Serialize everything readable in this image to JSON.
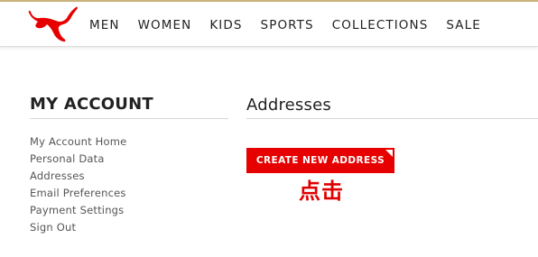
{
  "colors": {
    "brand_red": "#e60000",
    "top_line": "#c9b37a",
    "annotation": "#e00000"
  },
  "header": {
    "logo_icon": "puma-cat-logo-icon",
    "nav": [
      "MEN",
      "WOMEN",
      "KIDS",
      "SPORTS",
      "COLLECTIONS",
      "SALE"
    ]
  },
  "sidebar": {
    "title": "MY ACCOUNT",
    "items": [
      "My Account Home",
      "Personal Data",
      "Addresses",
      "Email Preferences",
      "Payment Settings",
      "Sign Out"
    ]
  },
  "main": {
    "title": "Addresses",
    "create_button_label": "CREATE NEW ADDRESS",
    "annotation_text": "点击"
  }
}
